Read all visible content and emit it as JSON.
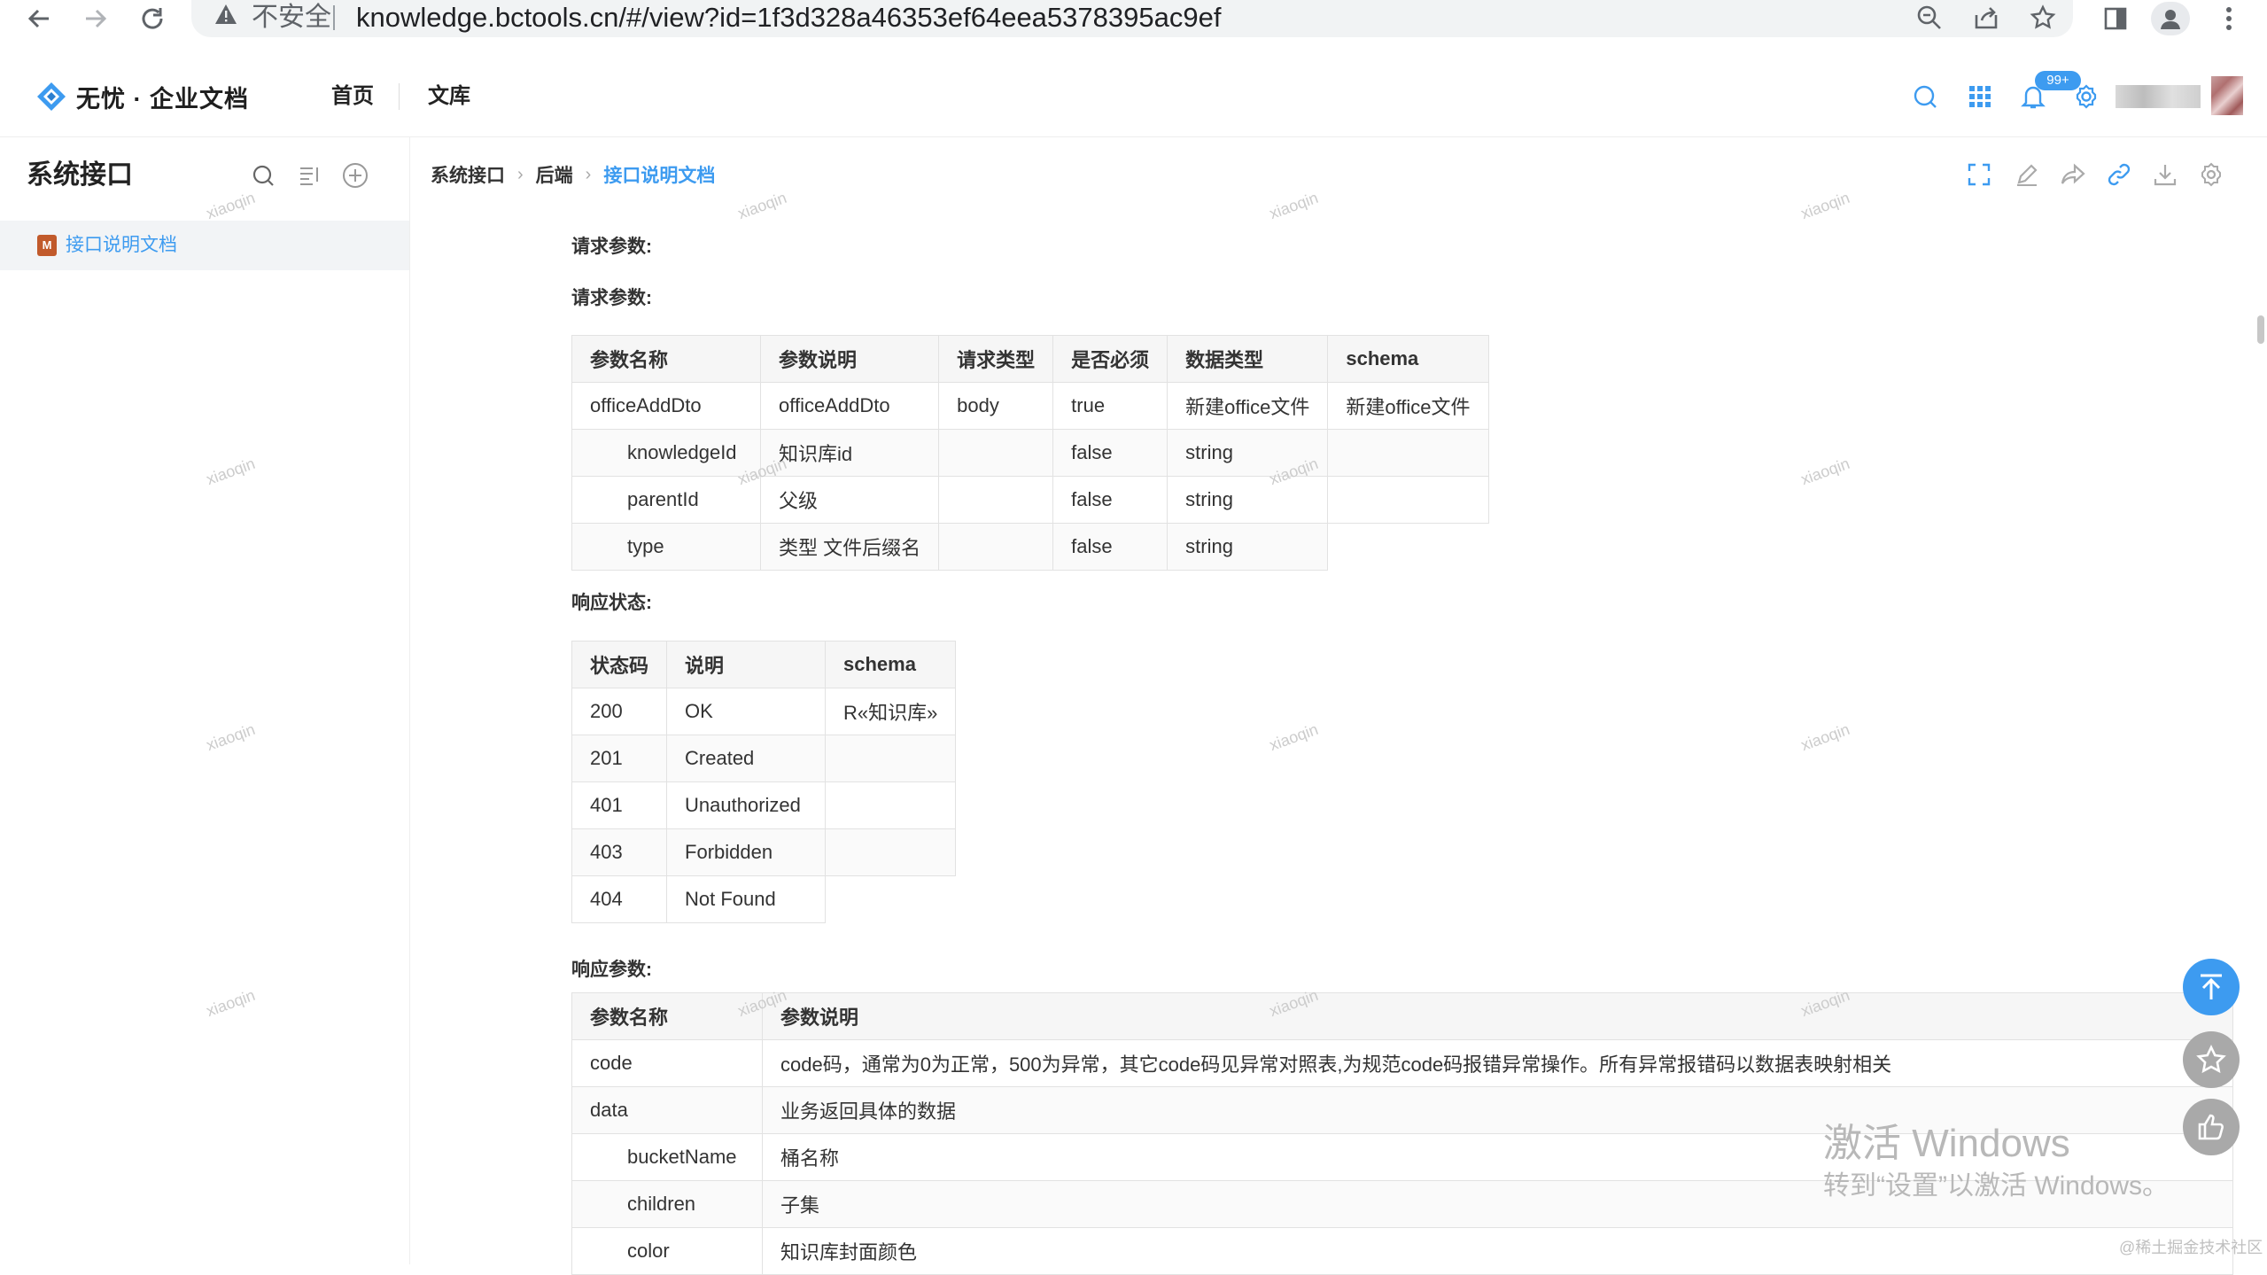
{
  "browser": {
    "insecure_label": "不安全",
    "url": "knowledge.bctools.cn/#/view?id=1f3d328a46353ef64eea5378395ac9ef"
  },
  "header": {
    "logo_text": "无忧 · 企业文档",
    "nav": [
      "首页",
      "文库"
    ],
    "notification_badge": "99+",
    "accent_color": "#3d9bf0"
  },
  "sidebar": {
    "title": "系统接口",
    "item_label": "接口说明文档",
    "item_icon": "M"
  },
  "breadcrumb": [
    "系统接口",
    "后端",
    "接口说明文档"
  ],
  "content": {
    "request_title_1": "请求参数:",
    "request_title_2": "请求参数:",
    "request_table": {
      "headers": [
        "参数名称",
        "参数说明",
        "请求类型",
        "是否必须",
        "数据类型",
        "schema"
      ],
      "rows": [
        [
          "officeAddDto",
          "officeAddDto",
          "body",
          "true",
          "新建office文件",
          "新建office文件"
        ],
        [
          "knowledgeId",
          "知识库id",
          "",
          "false",
          "string",
          ""
        ],
        [
          "parentId",
          "父级",
          "",
          "false",
          "string",
          ""
        ],
        [
          "type",
          "类型 文件后缀名",
          "",
          "false",
          "string",
          ""
        ]
      ]
    },
    "status_title": "响应状态:",
    "status_table": {
      "headers": [
        "状态码",
        "说明",
        "schema"
      ],
      "rows": [
        [
          "200",
          "OK",
          "R«知识库»"
        ],
        [
          "201",
          "Created",
          ""
        ],
        [
          "401",
          "Unauthorized",
          ""
        ],
        [
          "403",
          "Forbidden",
          ""
        ],
        [
          "404",
          "Not Found",
          ""
        ]
      ]
    },
    "response_title": "响应参数:",
    "response_table": {
      "headers": [
        "参数名称",
        "参数说明"
      ],
      "rows": [
        [
          "code",
          "code码，通常为0为正常，500为异常，其它code码见异常对照表,为规范code码报错异常操作。所有异常报错码以数据表映射相关"
        ],
        [
          "data",
          "业务返回具体的数据"
        ],
        [
          "bucketName",
          "桶名称"
        ],
        [
          "children",
          "子集"
        ],
        [
          "color",
          "知识库封面颜色"
        ]
      ]
    }
  },
  "watermark_text": "xiaoqin",
  "windows_activation": {
    "line1": "激活 Windows",
    "line2": "转到“设置”以激活 Windows。"
  },
  "corner_watermark": "@稀土掘金技术社区"
}
